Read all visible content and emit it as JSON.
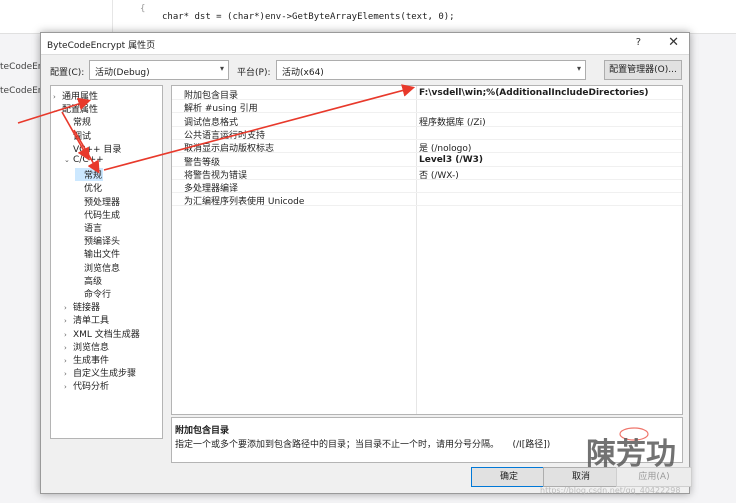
{
  "background": {
    "code_brace": "{",
    "code_line": "char* dst = (char*)env->GetByteArrayElements(text, 0);",
    "side_items": [
      "teCodeEnc",
      "teCodeEnc"
    ]
  },
  "dialog": {
    "title": "ByteCodeEncrypt 属性页",
    "help": "?",
    "close": "✕"
  },
  "toolbar": {
    "config_label": "配置(C):",
    "config_value": "活动(Debug)",
    "platform_label": "平台(P):",
    "platform_value": "活动(x64)",
    "manager_button": "配置管理器(O)..."
  },
  "tree": {
    "items": [
      {
        "label": "通用属性",
        "indent": 0,
        "twisty": "›"
      },
      {
        "label": "配置属性",
        "indent": 0,
        "twisty": "⌄"
      },
      {
        "label": "常规",
        "indent": 1,
        "twisty": ""
      },
      {
        "label": "调试",
        "indent": 1,
        "twisty": ""
      },
      {
        "label": "VC++ 目录",
        "indent": 1,
        "twisty": ""
      },
      {
        "label": "C/C++",
        "indent": 1,
        "twisty": "⌄"
      },
      {
        "label": "常规",
        "indent": 2,
        "twisty": "",
        "selected": true
      },
      {
        "label": "优化",
        "indent": 2,
        "twisty": ""
      },
      {
        "label": "预处理器",
        "indent": 2,
        "twisty": ""
      },
      {
        "label": "代码生成",
        "indent": 2,
        "twisty": ""
      },
      {
        "label": "语言",
        "indent": 2,
        "twisty": ""
      },
      {
        "label": "预编译头",
        "indent": 2,
        "twisty": ""
      },
      {
        "label": "输出文件",
        "indent": 2,
        "twisty": ""
      },
      {
        "label": "浏览信息",
        "indent": 2,
        "twisty": ""
      },
      {
        "label": "高级",
        "indent": 2,
        "twisty": ""
      },
      {
        "label": "命令行",
        "indent": 2,
        "twisty": ""
      },
      {
        "label": "链接器",
        "indent": 1,
        "twisty": "›"
      },
      {
        "label": "清单工具",
        "indent": 1,
        "twisty": "›"
      },
      {
        "label": "XML 文档生成器",
        "indent": 1,
        "twisty": "›"
      },
      {
        "label": "浏览信息",
        "indent": 1,
        "twisty": "›"
      },
      {
        "label": "生成事件",
        "indent": 1,
        "twisty": "›"
      },
      {
        "label": "自定义生成步骤",
        "indent": 1,
        "twisty": "›"
      },
      {
        "label": "代码分析",
        "indent": 1,
        "twisty": "›"
      }
    ]
  },
  "grid": {
    "rows": [
      {
        "name": "附加包含目录",
        "value": "F:\\vsdell\\win;%(AdditionalIncludeDirectories)",
        "bold": true
      },
      {
        "name": "解析 #using 引用",
        "value": "",
        "bold": false
      },
      {
        "name": "调试信息格式",
        "value": "程序数据库 (/Zi)",
        "bold": false
      },
      {
        "name": "公共语言运行时支持",
        "value": "",
        "bold": false
      },
      {
        "name": "取消显示启动版权标志",
        "value": "是 (/nologo)",
        "bold": false
      },
      {
        "name": "警告等级",
        "value": "Level3 (/W3)",
        "bold": true
      },
      {
        "name": "将警告视为错误",
        "value": "否 (/WX-)",
        "bold": false
      },
      {
        "name": "多处理器编译",
        "value": "",
        "bold": false
      },
      {
        "name": "为汇编程序列表使用 Unicode",
        "value": "",
        "bold": false
      }
    ]
  },
  "description": {
    "title": "附加包含目录",
    "text": "指定一个或多个要添加到包含路径中的目录；当目录不止一个时，请用分号分隔。　　(/I[路径])"
  },
  "buttons": {
    "ok": "确定",
    "cancel": "取消",
    "apply": "应用(A)"
  },
  "overlay": {
    "arrow_color": "#e8392b",
    "stamp_text": "陳芳功",
    "watermark": "https://blog.csdn.net/qq_40422298"
  }
}
